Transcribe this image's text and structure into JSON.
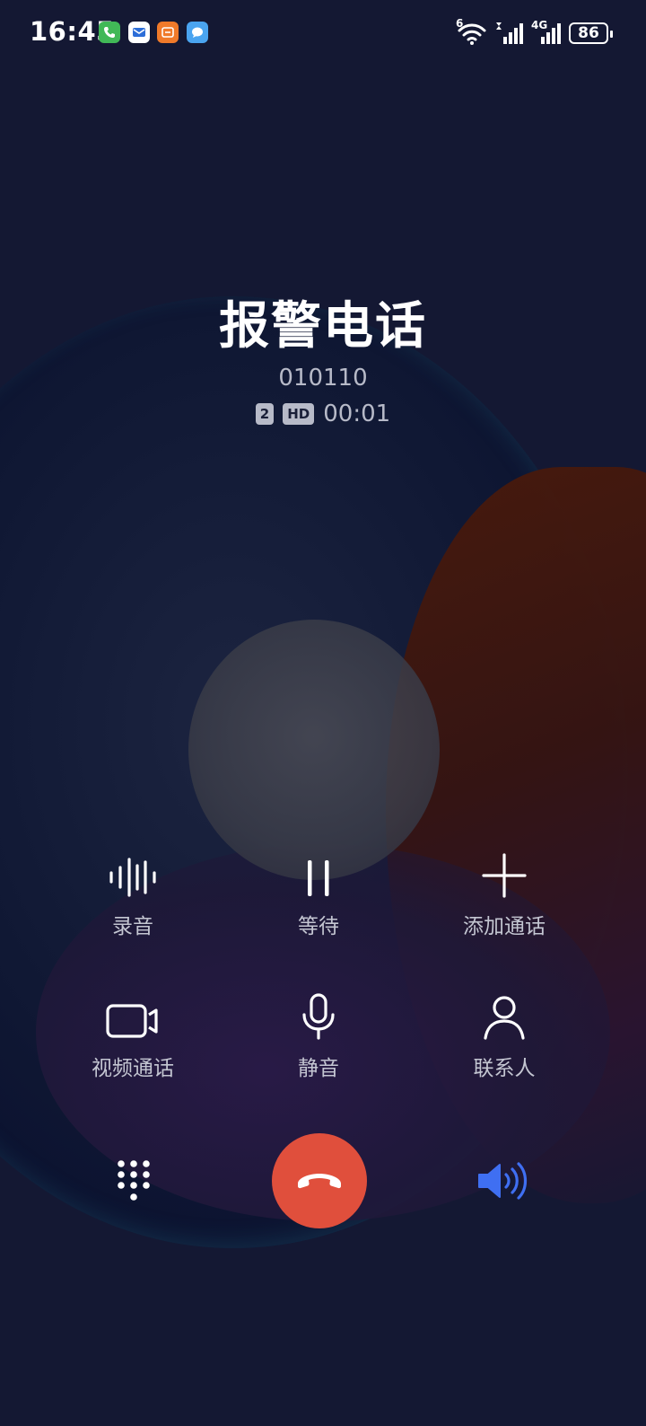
{
  "status": {
    "time": "16:45",
    "network_labels": [
      "6",
      "4G"
    ],
    "battery": "86"
  },
  "call": {
    "name": "报警电话",
    "number": "010110",
    "sim_tag": "2",
    "hd_tag": "HD",
    "duration": "00:01"
  },
  "controls": {
    "record": "录音",
    "hold": "等待",
    "add_call": "添加通话",
    "video_call": "视频通话",
    "mute": "静音",
    "contacts": "联系人"
  },
  "colors": {
    "end_call": "#e04f3c",
    "speaker_active": "#3f6ff2"
  }
}
